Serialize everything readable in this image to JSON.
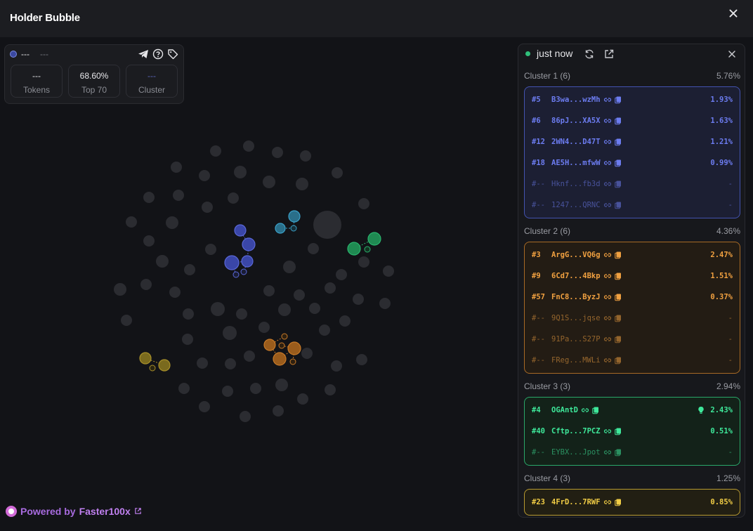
{
  "header": {
    "title": "Holder Bubble"
  },
  "stats": {
    "token_name": "---",
    "token_symbol": "---",
    "boxes": [
      {
        "value": "---",
        "label": "Tokens"
      },
      {
        "value": "68.60%",
        "label": "Top 70"
      },
      {
        "value": "---",
        "label": "Cluster"
      }
    ]
  },
  "panel": {
    "updated": "just now",
    "clusters": [
      {
        "title": "Cluster 1 (6)",
        "pct": "5.76%",
        "theme": "c-blue",
        "rows": [
          {
            "rank": "#5",
            "addr": "B3wa...wzMh",
            "pct": "1.93%",
            "dim": false
          },
          {
            "rank": "#6",
            "addr": "86pJ...XA5X",
            "pct": "1.63%",
            "dim": false
          },
          {
            "rank": "#12",
            "addr": "2WN4...D47T",
            "pct": "1.21%",
            "dim": false
          },
          {
            "rank": "#18",
            "addr": "AE5H...mfwW",
            "pct": "0.99%",
            "dim": false
          },
          {
            "rank": "#--",
            "addr": "Hknf...fb3d",
            "pct": "-",
            "dim": true
          },
          {
            "rank": "#--",
            "addr": "1247...QRNC",
            "pct": "-",
            "dim": true
          }
        ]
      },
      {
        "title": "Cluster 2 (6)",
        "pct": "4.36%",
        "theme": "c-orange",
        "rows": [
          {
            "rank": "#3",
            "addr": "ArgG...VQ6g",
            "pct": "2.47%",
            "dim": false
          },
          {
            "rank": "#9",
            "addr": "6Cd7...4Bkp",
            "pct": "1.51%",
            "dim": false
          },
          {
            "rank": "#57",
            "addr": "FnC8...ByzJ",
            "pct": "0.37%",
            "dim": false
          },
          {
            "rank": "#--",
            "addr": "9Q1S...jqse",
            "pct": "-",
            "dim": true
          },
          {
            "rank": "#--",
            "addr": "91Pa...S27P",
            "pct": "-",
            "dim": true
          },
          {
            "rank": "#--",
            "addr": "FReg...MWLi",
            "pct": "-",
            "dim": true
          }
        ]
      },
      {
        "title": "Cluster 3 (3)",
        "pct": "2.94%",
        "theme": "c-green",
        "rows": [
          {
            "rank": "#4",
            "addr": "OGAntD",
            "pct": "2.43%",
            "dim": false,
            "bulb": true
          },
          {
            "rank": "#40",
            "addr": "Cftp...7PCZ",
            "pct": "0.51%",
            "dim": false
          },
          {
            "rank": "#--",
            "addr": "EYBX...Jpot",
            "pct": "-",
            "dim": true
          }
        ]
      },
      {
        "title": "Cluster 4 (3)",
        "pct": "1.25%",
        "theme": "c-yellow",
        "rows": [
          {
            "rank": "#23",
            "addr": "4FrD...7RWF",
            "pct": "0.85%",
            "dim": false
          }
        ]
      }
    ]
  },
  "footer": {
    "powered_prefix": "Powered by",
    "powered_name": "Faster100x"
  },
  "colors": {
    "blue": "#5a68d8",
    "teal": "#3aa0c8",
    "green": "#2ab56e",
    "orange": "#c87a28",
    "yellow": "#a8902a",
    "grey": "#2b2c31"
  }
}
